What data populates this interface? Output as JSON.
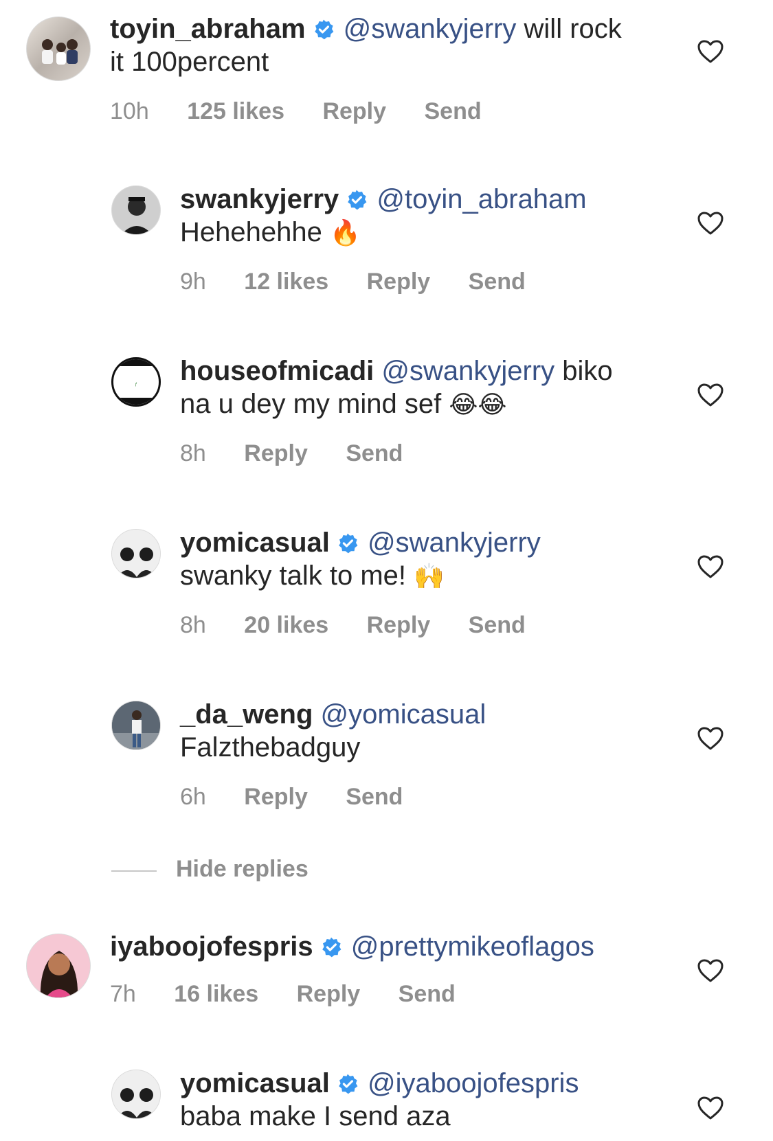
{
  "comments": [
    {
      "username": "toyin_abraham",
      "verified": true,
      "mention": "@swankyjerry",
      "text_line1": " will rock",
      "text_line2": "it 100percent",
      "time": "10h",
      "likes": "125 likes",
      "reply": "Reply",
      "send": "Send"
    },
    {
      "username": "swankyjerry",
      "verified": true,
      "mention": "@toyin_abraham",
      "text_line2": "Hehehehhe",
      "emoji": "🔥",
      "time": "9h",
      "likes": "12 likes",
      "reply": "Reply",
      "send": "Send"
    },
    {
      "username": "houseofmicadi",
      "verified": false,
      "mention": "@swankyjerry",
      "text_line1": " biko",
      "text_line2": "na u dey my mind sef",
      "emoji": "😂😂",
      "time": "8h",
      "reply": "Reply",
      "send": "Send"
    },
    {
      "username": "yomicasual",
      "verified": true,
      "mention": "@swankyjerry",
      "text_line2": "swanky talk to me!",
      "emoji": "🙌",
      "time": "8h",
      "likes": "20 likes",
      "reply": "Reply",
      "send": "Send"
    },
    {
      "username": "_da_weng",
      "verified": false,
      "mention": "@yomicasual",
      "text_line2": "Falzthebadguy",
      "time": "6h",
      "reply": "Reply",
      "send": "Send"
    },
    {
      "username": "iyaboojofespris",
      "verified": true,
      "mention": "@prettymikeoflagos",
      "time": "7h",
      "likes": "16 likes",
      "reply": "Reply",
      "send": "Send"
    },
    {
      "username": "yomicasual",
      "verified": true,
      "mention": "@iyaboojofespris",
      "text_line2": "baba make I send aza"
    }
  ],
  "hide_replies": "Hide replies",
  "colors": {
    "mention": "#385185",
    "meta": "#8e8e8e",
    "verified": "#3897f0",
    "text": "#262626"
  },
  "icons": {
    "verified": "verified-badge-icon",
    "like": "heart-outline-icon"
  }
}
